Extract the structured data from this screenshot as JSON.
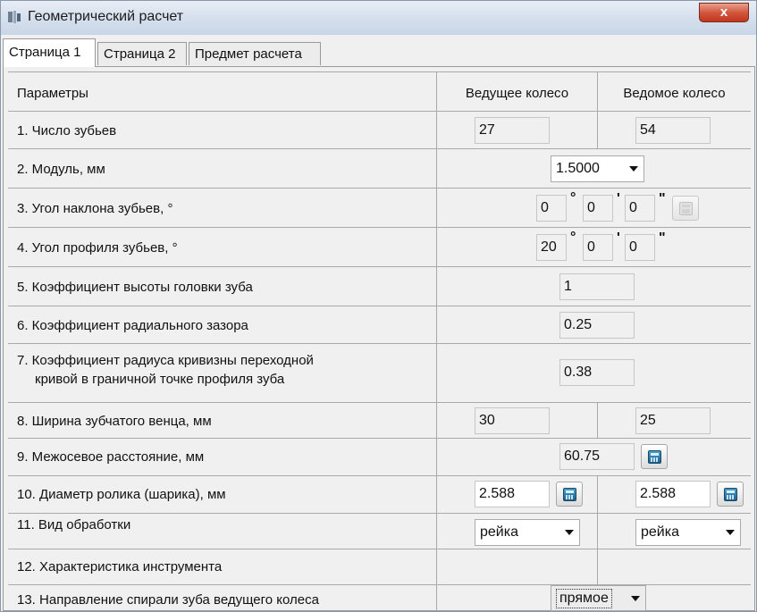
{
  "window": {
    "title": "Геометрический расчет",
    "close_label": "x"
  },
  "tabs": [
    {
      "label": "Страница 1",
      "active": true
    },
    {
      "label": "Страница 2",
      "active": false
    },
    {
      "label": "Предмет расчета",
      "active": false
    }
  ],
  "table": {
    "headers": {
      "params": "Параметры",
      "driving": "Ведущее колесо",
      "driven": "Ведомое колесо"
    },
    "rows": {
      "teeth": {
        "label": "1. Число зубьев",
        "driving": "27",
        "driven": "54"
      },
      "module": {
        "label": "2. Модуль, мм",
        "value": "1.5000"
      },
      "helix_angle": {
        "label": "3. Угол наклона зубьев, °",
        "deg": "0",
        "min": "0",
        "sec": "0",
        "deg_sym": "°",
        "min_sym": "'",
        "sec_sym": "\""
      },
      "profile_angle": {
        "label": "4. Угол профиля зубьев, °",
        "deg": "20",
        "min": "0",
        "sec": "0",
        "deg_sym": "°",
        "min_sym": "'",
        "sec_sym": "\""
      },
      "addendum_coef": {
        "label": "5. Коэффициент высоты головки зуба",
        "value": "1"
      },
      "clearance_coef": {
        "label": "6. Коэффициент радиального зазора",
        "value": "0.25"
      },
      "fillet_coef": {
        "label_line1": "7. Коэффициент радиуса кривизны переходной",
        "label_line2": "кривой в граничной точке профиля зуба",
        "value": "0.38"
      },
      "face_width": {
        "label": "8. Ширина зубчатого венца, мм",
        "driving": "30",
        "driven": "25"
      },
      "center_distance": {
        "label": "9. Межосевое расстояние, мм",
        "value": "60.75"
      },
      "roller_diameter": {
        "label": "10. Диаметр ролика (шарика), мм",
        "driving": "2.588",
        "driven": "2.588"
      },
      "machining": {
        "label": "11. Вид обработки",
        "driving": "рейка",
        "driven": "рейка"
      },
      "tool": {
        "label": "12. Характеристика инструмента"
      },
      "spiral_direction": {
        "label": "13. Направление спирали зуба ведущего колеса",
        "value": "прямое"
      }
    }
  }
}
